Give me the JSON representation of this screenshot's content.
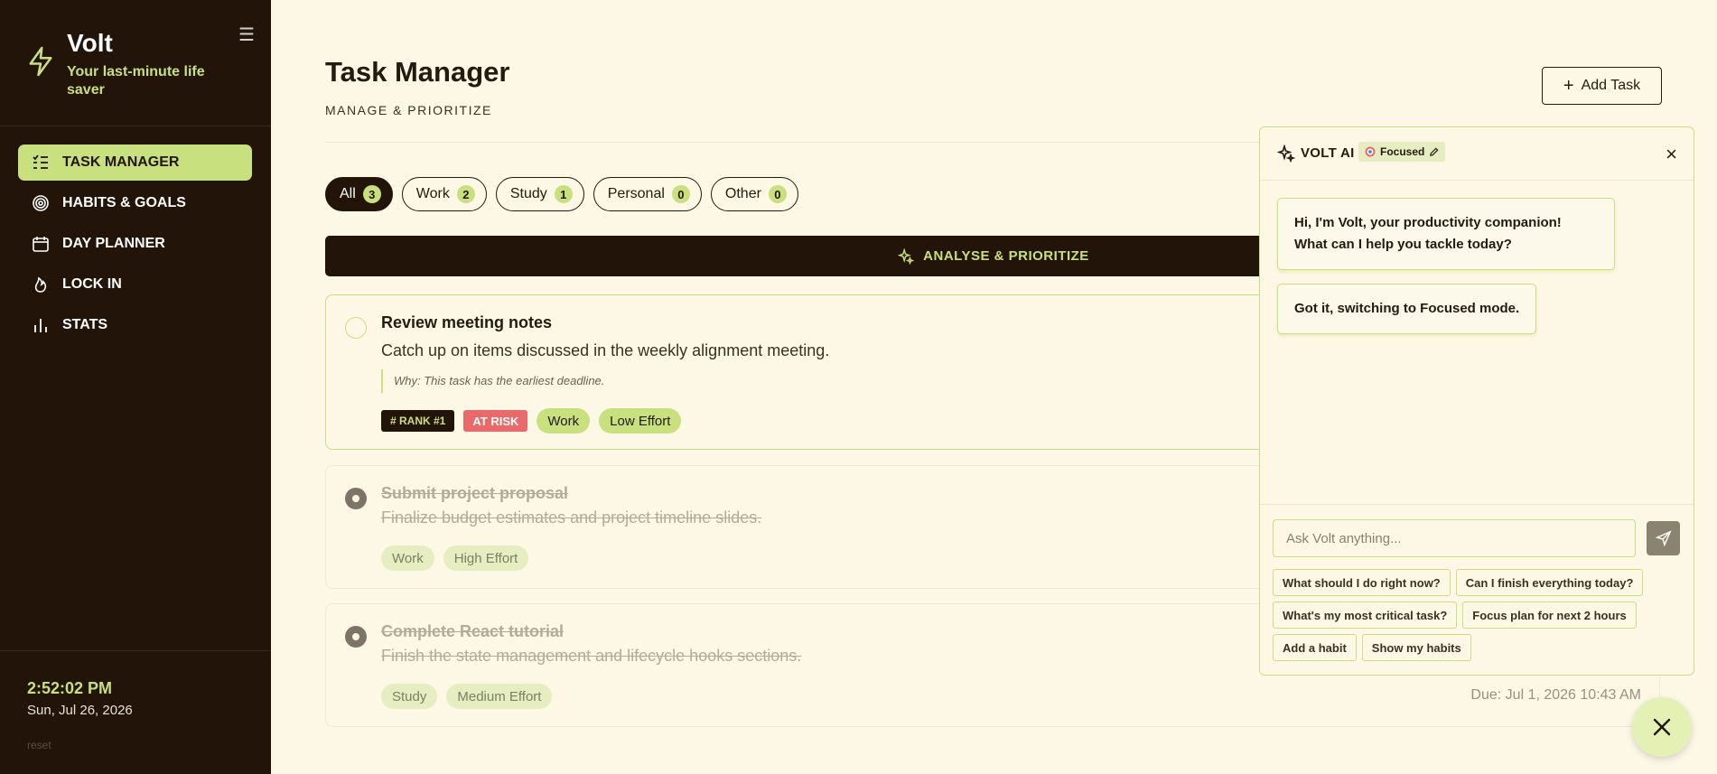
{
  "brand": {
    "name": "Volt",
    "tagline": "Your last-minute life saver"
  },
  "sidebar": {
    "items": [
      {
        "label": "TASK MANAGER",
        "active": true,
        "icon": "list-check-icon"
      },
      {
        "label": "HABITS & GOALS",
        "active": false,
        "icon": "target-icon"
      },
      {
        "label": "DAY PLANNER",
        "active": false,
        "icon": "calendar-icon"
      },
      {
        "label": "LOCK IN",
        "active": false,
        "icon": "flame-icon"
      },
      {
        "label": "STATS",
        "active": false,
        "icon": "bar-chart-icon"
      }
    ],
    "clock": "2:52:02 PM",
    "date": "Sun, Jul 26, 2026",
    "reset_label": "reset"
  },
  "header": {
    "title": "Task Manager",
    "subtitle": "MANAGE & PRIORITIZE",
    "add_task_label": "Add Task"
  },
  "filters": [
    {
      "label": "All",
      "count": "3",
      "active": true
    },
    {
      "label": "Work",
      "count": "2",
      "active": false
    },
    {
      "label": "Study",
      "count": "1",
      "active": false
    },
    {
      "label": "Personal",
      "count": "0",
      "active": false
    },
    {
      "label": "Other",
      "count": "0",
      "active": false
    }
  ],
  "analyse_label": "ANALYSE & PRIORITIZE",
  "tasks": [
    {
      "title": "Review meeting notes",
      "description": "Catch up on items discussed in the weekly alignment meeting.",
      "why": "Why: This task has the earliest deadline.",
      "rank": "# RANK #1",
      "risk": "AT RISK",
      "category": "Work",
      "effort": "Low Effort",
      "done": false
    },
    {
      "title": "Submit project proposal",
      "description": "Finalize budget estimates and project timeline slides.",
      "category": "Work",
      "effort": "High Effort",
      "done": true
    },
    {
      "title": "Complete React tutorial",
      "description": "Finish the state management and lifecycle hooks sections.",
      "category": "Study",
      "effort": "Medium Effort",
      "due": "Due: Jul 1, 2026 10:43 AM",
      "done": true
    }
  ],
  "ai": {
    "title": "VOLT AI",
    "mode": "Focused",
    "messages": [
      "Hi, I'm Volt, your productivity companion! What can I help you tackle today?",
      "Got it, switching to Focused mode."
    ],
    "input_placeholder": "Ask Volt anything...",
    "suggestions": [
      "What should I do right now?",
      "Can I finish everything today?",
      "What's my most critical task?",
      "Focus plan for next 2 hours",
      "Add a habit",
      "Show my habits"
    ]
  },
  "colors": {
    "accent": "#c8e07e",
    "sidebar_bg": "#221409",
    "page_bg": "#fdf7e6",
    "risk": "#e96a6a"
  }
}
